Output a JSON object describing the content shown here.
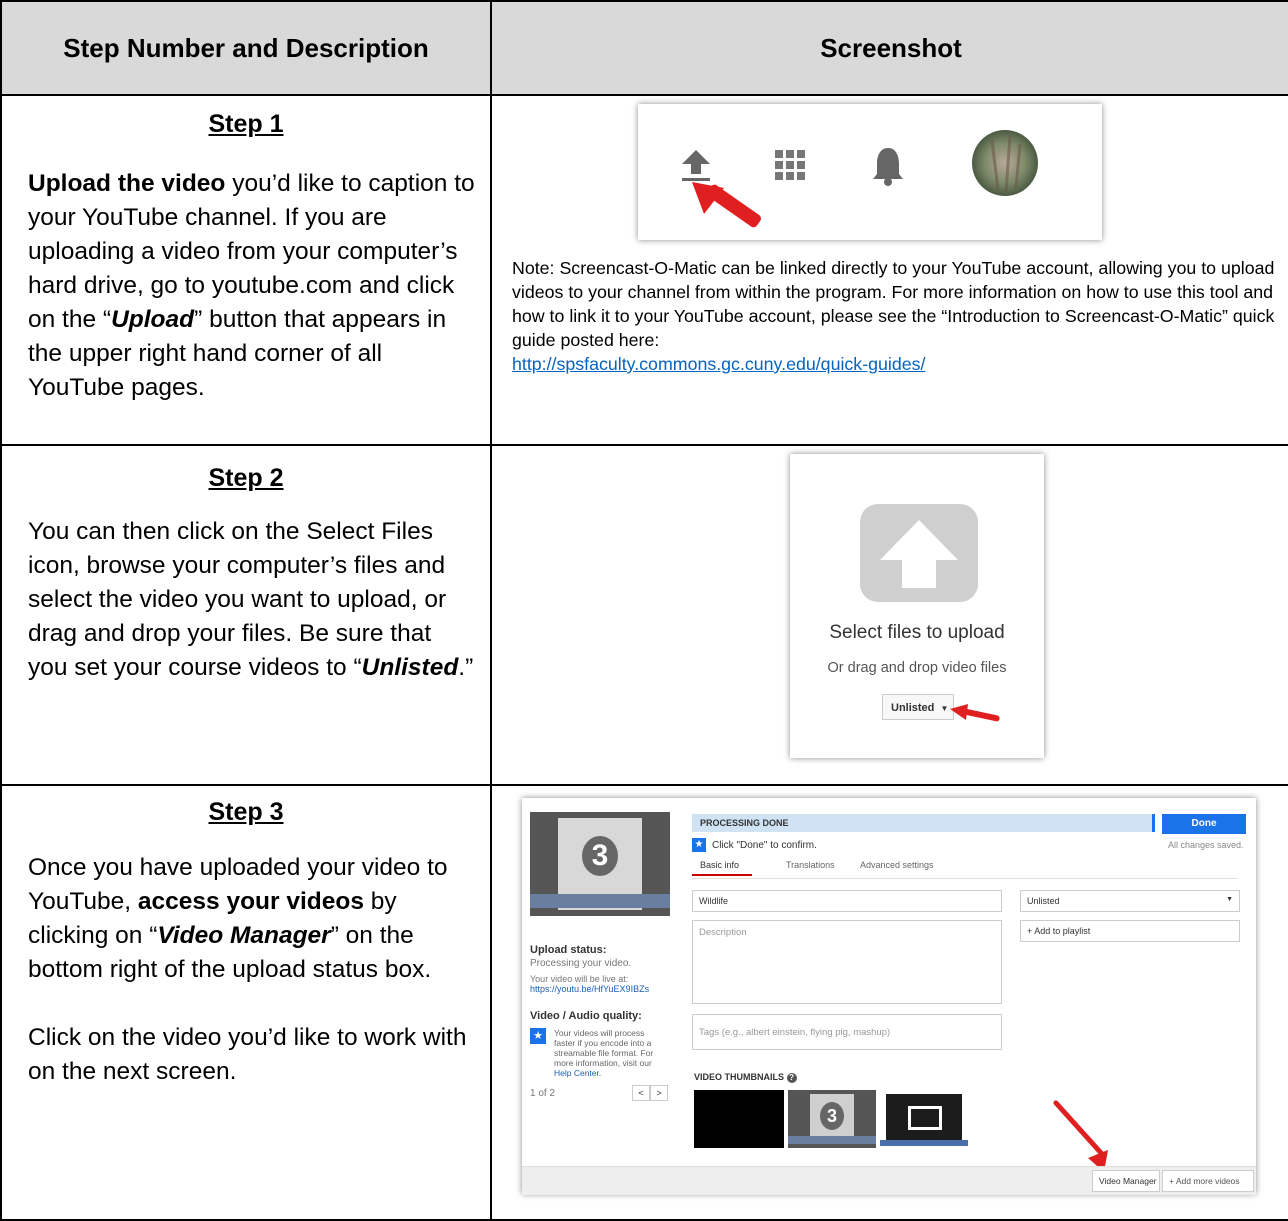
{
  "header": {
    "col1": "Step Number and Description",
    "col2": "Screenshot"
  },
  "step1": {
    "title": "Step 1",
    "desc_bold": "Upload the video",
    "desc_a": " you’d like to caption to your YouTube channel. If you are uploading a video from your computer’s hard drive, go to youtube.com and click on the “",
    "desc_upload": "Upload",
    "desc_b": "” button that appears in the upper right hand corner of all YouTube pages.",
    "note_text": "Note: Screencast-O-Matic can be linked directly to your YouTube account, allowing you to upload videos to your channel from within the program. For more information on how to use this tool and how to link it to your YouTube account, please see the “Introduction to Screencast-O-Matic” quick guide posted here:",
    "note_link": "http://spsfaculty.commons.gc.cuny.edu/quick-guides/"
  },
  "step2": {
    "title": "Step 2",
    "desc_a": "You can then click on the Select Files icon, browse your computer’s files and select the video you want to upload, or drag and drop your files. Be sure that you set your course videos to “",
    "desc_unlisted": "Unlisted",
    "desc_b": ".”",
    "shot_title": "Select files to upload",
    "shot_sub": "Or drag and drop video files",
    "privacy": "Unlisted"
  },
  "step3": {
    "title": "Step 3",
    "desc_a": "Once you have uploaded your video to YouTube, ",
    "desc_bold": "access your videos",
    "desc_b": " by clicking on “",
    "desc_vm": "Video Manager",
    "desc_c": "” on the bottom right of the upload status box.",
    "desc_2": "Click on the video you’d like to work with on the next screen.",
    "shot": {
      "processing": "PROCESSING DONE",
      "done": "Done",
      "confirm": "Click \"Done\" to confirm.",
      "saved": "All changes saved.",
      "tab_basic": "Basic info",
      "tab_translations": "Translations",
      "tab_advanced": "Advanced settings",
      "title_value": "Wildlife",
      "privacy": "Unlisted",
      "description_ph": "Description",
      "add_playlist": "+ Add to playlist",
      "tags_ph": "Tags (e.g., albert einstein, flying pig, mashup)",
      "upload_status": "Upload status:",
      "processing_video": "Processing your video.",
      "live_at": "Your video will be live at:",
      "url": "https://youtu.be/HfYuEX9IBZs",
      "quality": "Video / Audio quality:",
      "quality_note": "Your videos will process faster if you encode into a streamable file format. For more information, visit our",
      "help_center": "Help Center.",
      "pager": "1 of 2",
      "thumbs": "VIDEO THUMBNAILS",
      "thumb_number": "3",
      "video_manager": "Video Manager",
      "add_more": "+ Add more videos"
    }
  }
}
